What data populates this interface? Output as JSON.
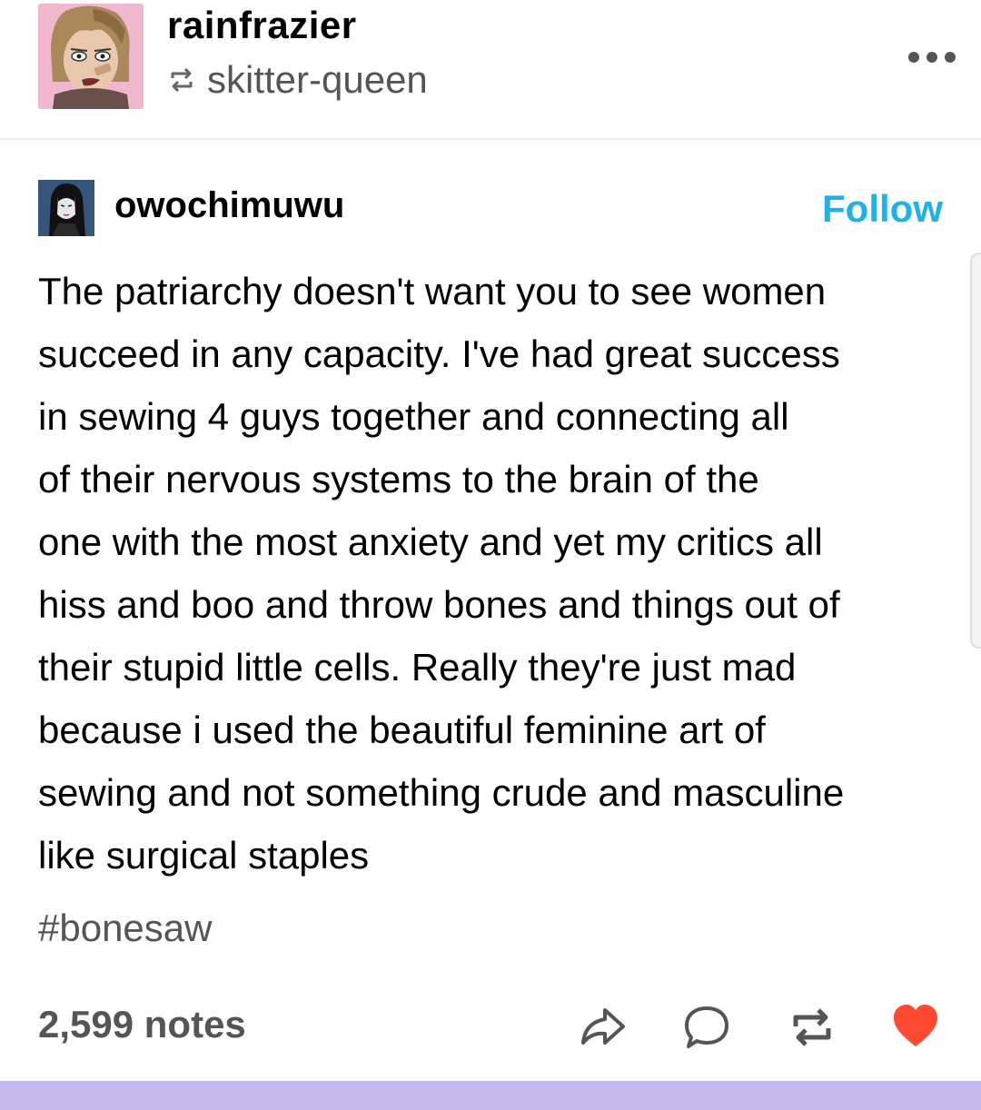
{
  "header": {
    "username": "rainfrazier",
    "reblogged_from": "skitter-queen"
  },
  "post": {
    "author": "owochimuwu",
    "follow_label": "Follow",
    "text_lines": [
      "The patriarchy doesn't want you to see women",
      "succeed in any capacity. I've had great success",
      "in sewing 4 guys together and connecting all",
      "of their nervous systems to the brain of the",
      "one with the most anxiety and yet my critics all",
      "hiss and boo and throw bones and things out of",
      "their stupid little cells. Really they're just mad",
      "because i used the beautiful feminine art of",
      "sewing and not something crude and masculine",
      "like surgical staples"
    ],
    "tag": "#bonesaw",
    "notes": "2,599 notes"
  },
  "icons": [
    "reblog-icon",
    "more-icon",
    "share-icon",
    "reply-icon",
    "reblog-icon",
    "heart-icon"
  ],
  "colors": {
    "follow": "#1eb2ea",
    "muted_text": "#555555",
    "heart": "#ff4930",
    "bottom_bar": "#c9b8ee"
  }
}
